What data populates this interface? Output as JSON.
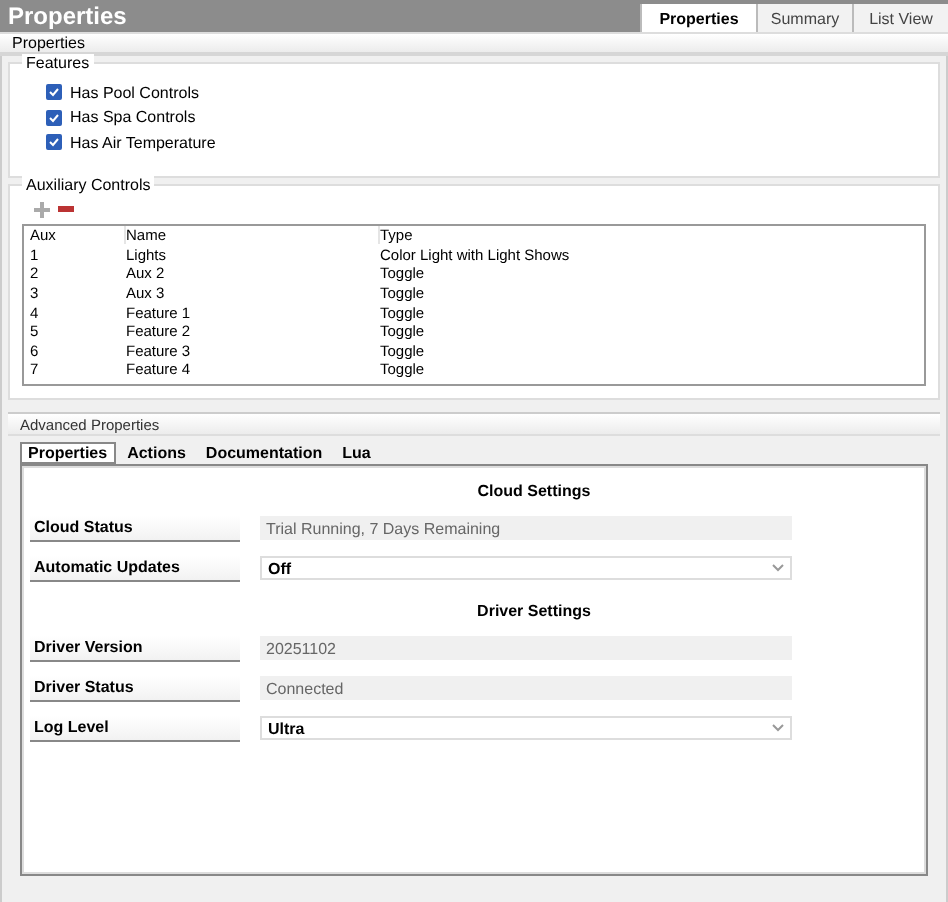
{
  "header": {
    "title": "Properties",
    "tabs": [
      {
        "label": "Properties",
        "selected": true
      },
      {
        "label": "Summary",
        "selected": false
      },
      {
        "label": "List View",
        "selected": false
      }
    ]
  },
  "section_title": "Properties",
  "features": {
    "title": "Features",
    "items": [
      {
        "label": "Has Pool Controls",
        "checked": true
      },
      {
        "label": "Has Spa Controls",
        "checked": true
      },
      {
        "label": "Has Air Temperature",
        "checked": true
      }
    ]
  },
  "auxiliary": {
    "title": "Auxiliary Controls",
    "columns": [
      "Aux",
      "Name",
      "Type"
    ],
    "rows": [
      [
        "1",
        "Lights",
        "Color Light with Light Shows"
      ],
      [
        "2",
        "Aux 2",
        "Toggle"
      ],
      [
        "3",
        "Aux 3",
        "Toggle"
      ],
      [
        "4",
        "Feature 1",
        "Toggle"
      ],
      [
        "5",
        "Feature 2",
        "Toggle"
      ],
      [
        "6",
        "Feature 3",
        "Toggle"
      ],
      [
        "7",
        "Feature 4",
        "Toggle"
      ]
    ]
  },
  "advanced": {
    "title": "Advanced Properties",
    "tabs": [
      {
        "label": "Properties",
        "selected": true
      },
      {
        "label": "Actions",
        "selected": false
      },
      {
        "label": "Documentation",
        "selected": false
      },
      {
        "label": "Lua",
        "selected": false
      }
    ],
    "items": [
      {
        "kind": "heading",
        "label": "Cloud Settings"
      },
      {
        "kind": "readonly",
        "label": "Cloud Status",
        "value": "Trial Running, 7 Days Remaining"
      },
      {
        "kind": "dropdown",
        "label": "Automatic Updates",
        "value": "Off"
      },
      {
        "kind": "heading",
        "label": "Driver Settings"
      },
      {
        "kind": "readonly",
        "label": "Driver Version",
        "value": "20251102"
      },
      {
        "kind": "readonly",
        "label": "Driver Status",
        "value": "Connected"
      },
      {
        "kind": "dropdown",
        "label": "Log Level",
        "value": "Ultra"
      }
    ]
  }
}
